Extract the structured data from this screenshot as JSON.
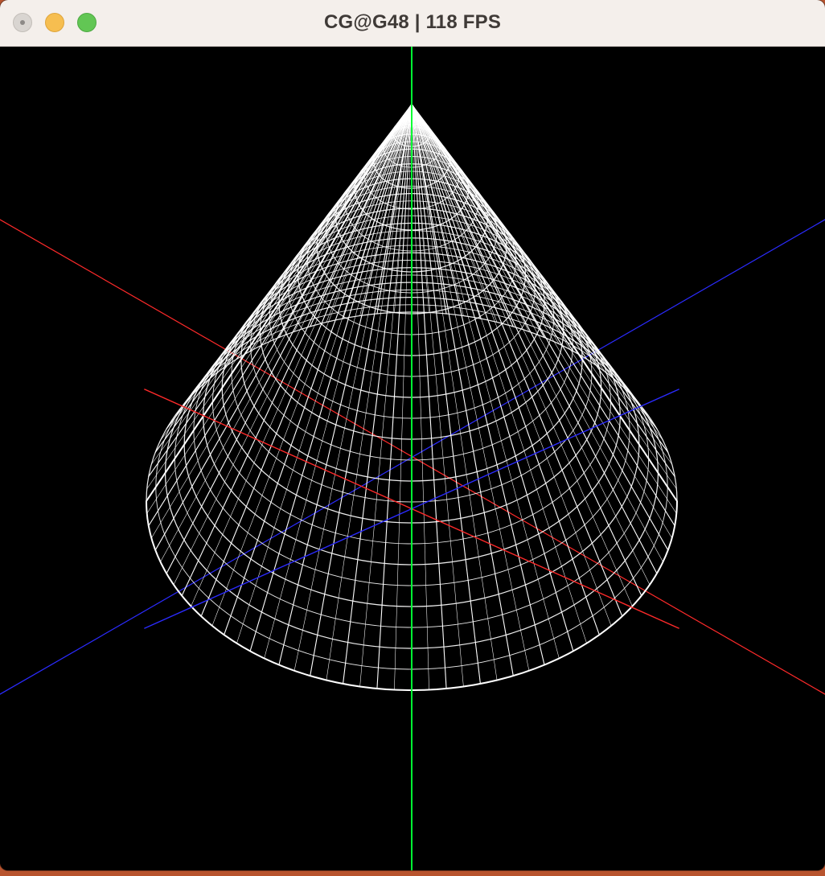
{
  "window": {
    "title": "CG@G48 | 118 FPS",
    "buttons": {
      "close": "close-button",
      "minimize": "minimize-button",
      "zoom": "zoom-button"
    }
  },
  "scene": {
    "background": "#000000",
    "axes": {
      "x_color": "#ff2a2a",
      "y_color": "#00ff33",
      "z_color": "#2b2bff"
    },
    "model": {
      "type": "cone",
      "wireframe_color": "#ffffff",
      "slices": 48,
      "stacks": 28
    }
  }
}
